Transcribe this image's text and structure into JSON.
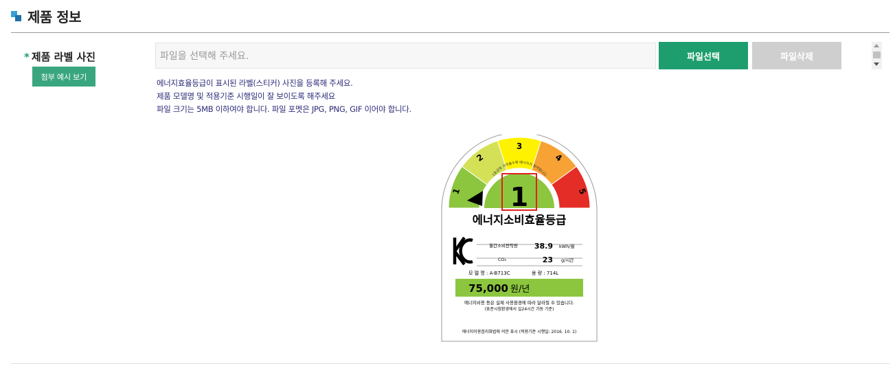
{
  "section": {
    "title": "제품 정보"
  },
  "field": {
    "required_mark": "*",
    "label": "제품 라벨 사진",
    "example_button": "첨부 예시 보기",
    "file_placeholder": "파일을 선택해 주세요.",
    "select_button": "파일선택",
    "delete_button": "파일삭제"
  },
  "help_lines": [
    "에너지효율등급이 표시된 라벨(스티커) 사진을 등록해 주세요.",
    "제품 모델명 및 적용기준 시행일이 잘 보이도록 해주세요",
    "파일 크기는 5MB 이하여야 합니다. 파일 포멧은 JPG, PNG, GIF 이어야 합니다."
  ],
  "energy_label": {
    "grades": [
      "1",
      "2",
      "3",
      "4",
      "5"
    ],
    "big_grade": "1",
    "arc_caption": "1등급에 가까울수록 에너지가 절약됩니다",
    "title": "에너지소비효율등급",
    "rows": [
      {
        "label": "월간소비전력량",
        "value": "38.9",
        "unit": "kWh/월"
      },
      {
        "label": "CO₂",
        "value": "23",
        "unit": "g/시간"
      }
    ],
    "model": "모 델 명 : A-B713C",
    "capacity": "용    량 : 714L",
    "cost": "75,000",
    "cost_unit": "원/년",
    "note1": "에너지비용 등은 실제 사용환경에 따라 달라질 수 있습니다.",
    "note2": "(표준시험환경에서 일24시간 가동 기준)",
    "footer": "에너지이용합리화법에 의한 표시 (적용기준 시행일: 2016. 10. 1)",
    "colors": {
      "grade1": "#8cc63f",
      "grade2": "#d4e157",
      "grade3": "#fff200",
      "grade4": "#f7a234",
      "grade5": "#e52d27",
      "highlight_box": "#e0201b",
      "cost_bar": "#8cc63f"
    }
  }
}
